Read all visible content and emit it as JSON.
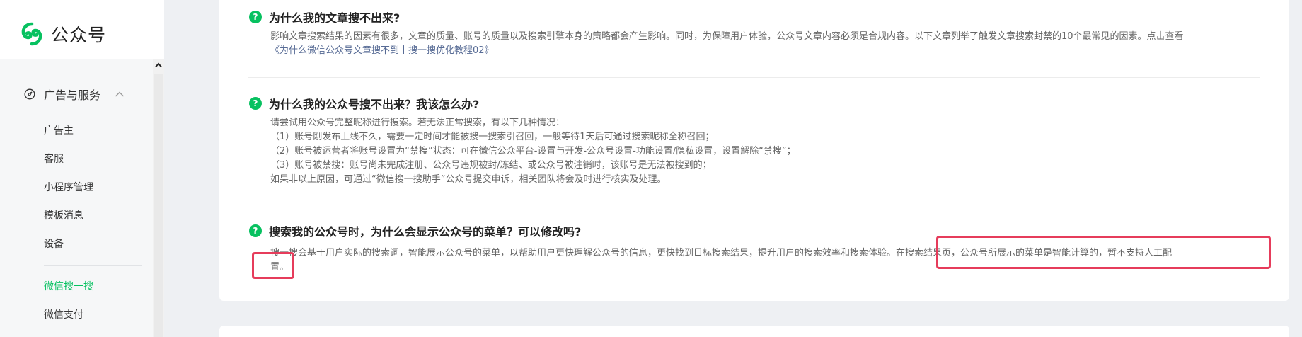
{
  "brand": {
    "name": "公众号",
    "color": "#07c160",
    "icon": "wechat-official-logo-icon"
  },
  "sidebar": {
    "group": {
      "label": "广告与服务",
      "icon": "compass-icon",
      "expand_icon": "chevron-up-icon"
    },
    "items": [
      {
        "label": "广告主",
        "active": false
      },
      {
        "label": "客服",
        "active": false
      },
      {
        "label": "小程序管理",
        "active": false
      },
      {
        "label": "模板消息",
        "active": false
      },
      {
        "label": "设备",
        "active": false
      },
      {
        "label": "微信搜一搜",
        "active": true
      },
      {
        "label": "微信支付",
        "active": false
      }
    ]
  },
  "faqs": [
    {
      "question": "为什么我的文章搜不出来?",
      "answer": "影响文章搜索结果的因素有很多，文章的质量、账号的质量以及搜索引擎本身的策略都会产生影响。同时，为保障用户体验，公众号文章内容必须是合规内容。以下文章列举了触发文章搜索封禁的10个最常见的因素。点击查看",
      "link": "《为什么微信公众号文章搜不到丨搜一搜优化教程02》"
    },
    {
      "question": "为什么我的公众号搜不出来？我该怎么办?",
      "lines": [
        "请尝试用公众号完整昵称进行搜索。若无法正常搜索，有以下几种情况：",
        "（1）账号刚发布上线不久，需要一定时间才能被搜一搜索引召回，一般等待1天后可通过搜索昵称全称召回；",
        "（2）账号被运营者将账号设置为“禁搜”状态：可在微信公众平台-设置与开发-公众号设置-功能设置/隐私设置，设置解除“禁搜”；",
        "（3）账号被禁搜：账号尚未完成注册、公众号违规被封/冻结、或公众号被注销时，该账号是无法被搜到的；",
        "如果非以上原因，可通过“微信搜一搜助手”公众号提交申诉，相关团队将会及时进行核实及处理。"
      ]
    },
    {
      "question": "搜索我的公众号时，为什么会显示公众号的菜单？可以修改吗?",
      "answer_main": "搜一搜会基于用户实际的搜索词，智能展示公众号的菜单，以帮助用户更快理解公众号的信息，更快找到目标搜索结果，提升用户的搜索效率和搜索体验。",
      "answer_highlight": "在搜索结果页，公众号所展示的菜单是智能计算的，暂不支持人工配",
      "answer_tail": "置。"
    }
  ],
  "colors": {
    "highlight": "#e63c5b",
    "link": "#576b95",
    "question_icon": "#07c160"
  }
}
